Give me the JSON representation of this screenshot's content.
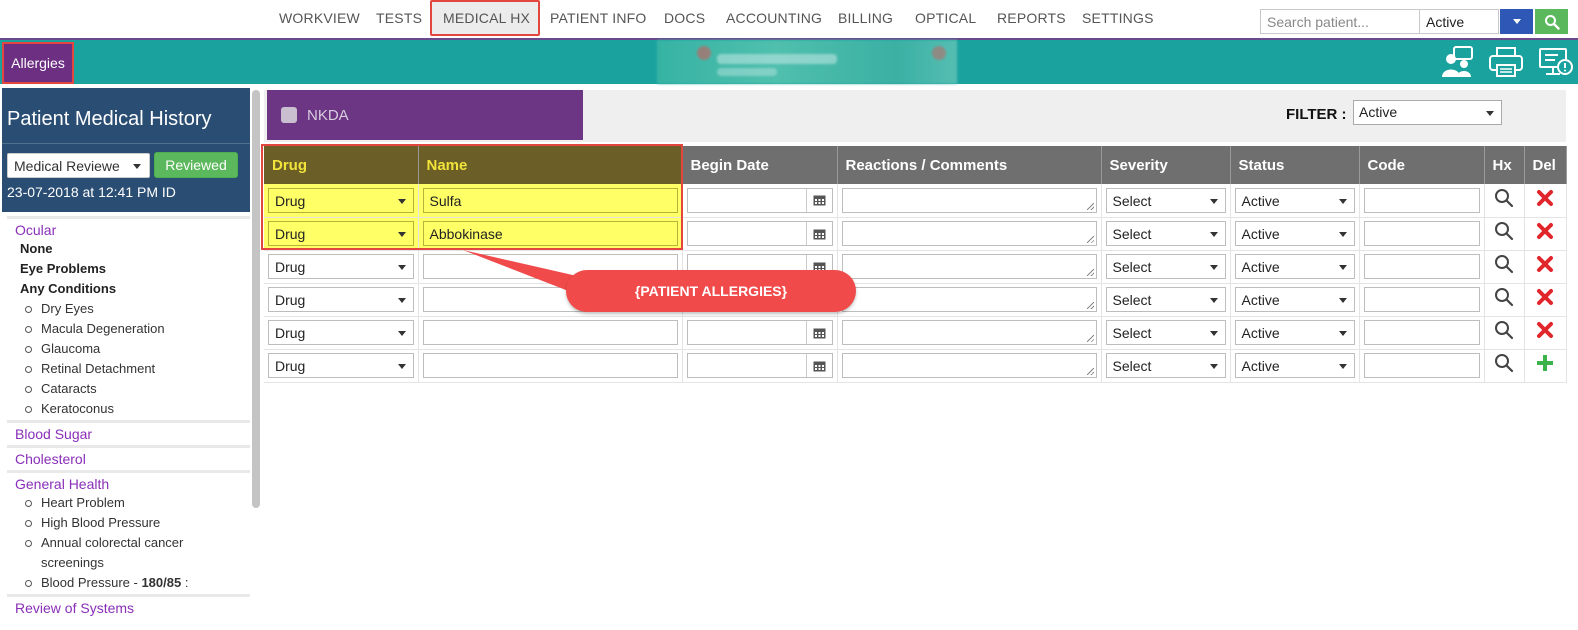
{
  "nav": {
    "items": [
      "WORKVIEW",
      "TESTS",
      "MEDICAL HX",
      "PATIENT INFO",
      "DOCS",
      "ACCOUNTING",
      "BILLING",
      "OPTICAL",
      "REPORTS",
      "SETTINGS"
    ],
    "active": "MEDICAL HX",
    "search_placeholder": "Search patient...",
    "search_status": "Active"
  },
  "tealbar": {
    "tab_label": "Allergies",
    "icons": [
      "users-chat-icon",
      "printer-icon",
      "monitor-alert-icon"
    ]
  },
  "sidebar": {
    "title": "Patient Medical History",
    "reviewer_select": "Medical Reviewe",
    "reviewed_button": "Reviewed",
    "review_date": "23-07-2018 at 12:41 PM ID",
    "sections": {
      "ocular": {
        "title": "Ocular",
        "lines": [
          "None",
          "Eye Problems",
          "Any Conditions"
        ],
        "bullets": [
          "Dry Eyes",
          "Macula Degeneration",
          "Glaucoma",
          "Retinal Detachment",
          "Cataracts",
          "Keratoconus"
        ]
      },
      "blood_sugar": {
        "title": "Blood Sugar"
      },
      "cholesterol": {
        "title": "Cholesterol"
      },
      "general_health": {
        "title": "General Health",
        "bullets": [
          "Heart Problem",
          "High Blood Pressure",
          "Annual colorectal cancer",
          "screenings"
        ],
        "bp_label": "Blood Pressure - ",
        "bp_value": "180/85",
        "bp_suffix": " :"
      },
      "review_of_systems": {
        "title": "Review of Systems"
      }
    }
  },
  "main": {
    "nkda_label": "NKDA",
    "filter_label": "FILTER :",
    "filter_value": "Active",
    "columns": [
      "Drug",
      "Name",
      "Begin Date",
      "Reactions / Comments",
      "Severity",
      "Status",
      "Code",
      "Hx",
      "Del"
    ],
    "rows": [
      {
        "type": "Drug",
        "name": "Sulfa",
        "severity": "Select",
        "status": "Active",
        "action": "delete"
      },
      {
        "type": "Drug",
        "name": "Abbokinase",
        "severity": "Select",
        "status": "Active",
        "action": "delete"
      },
      {
        "type": "Drug",
        "name": "",
        "severity": "Select",
        "status": "Active",
        "action": "delete"
      },
      {
        "type": "Drug",
        "name": "",
        "severity": "Select",
        "status": "Active",
        "action": "delete"
      },
      {
        "type": "Drug",
        "name": "",
        "severity": "Select",
        "status": "Active",
        "action": "delete"
      },
      {
        "type": "Drug",
        "name": "",
        "severity": "Select",
        "status": "Active",
        "action": "add"
      }
    ],
    "callout": "{PATIENT ALLERGIES}"
  },
  "colors": {
    "teal": "#1aa39e",
    "purple": "#6c2f82",
    "navy": "#2a4d74",
    "highlight_yellow": "#ffff66",
    "callout_red": "#f04a4a",
    "delete_red": "#e0262b",
    "add_green": "#3cb34a"
  }
}
